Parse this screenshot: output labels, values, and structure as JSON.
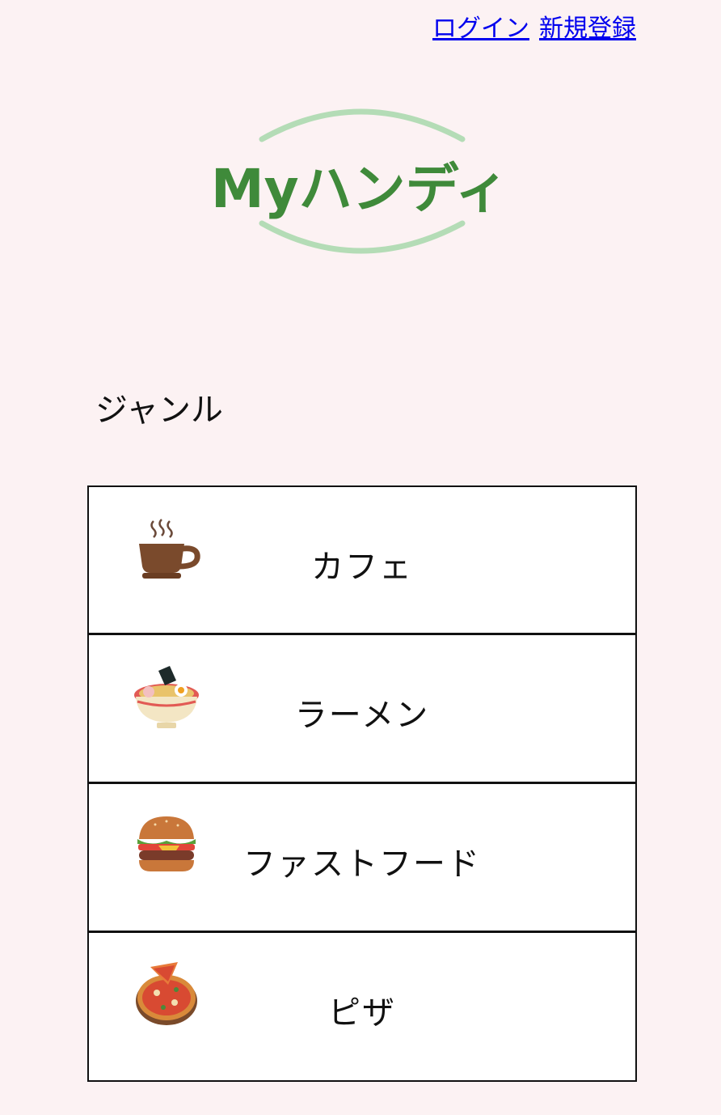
{
  "header": {
    "login_label": "ログイン",
    "register_label": "新規登録"
  },
  "logo": {
    "text": "Myハンディ",
    "text_color": "#3f8a3a",
    "arc_color": "#b4dcb6"
  },
  "genres": {
    "title": "ジャンル",
    "items": [
      {
        "label": "カフェ",
        "icon": "coffee-cup-icon"
      },
      {
        "label": "ラーメン",
        "icon": "ramen-bowl-icon"
      },
      {
        "label": "ファストフード",
        "icon": "hamburger-icon"
      },
      {
        "label": "ピザ",
        "icon": "pizza-icon"
      }
    ]
  },
  "colors": {
    "background": "#fcf2f3",
    "link": "#0000ee"
  }
}
